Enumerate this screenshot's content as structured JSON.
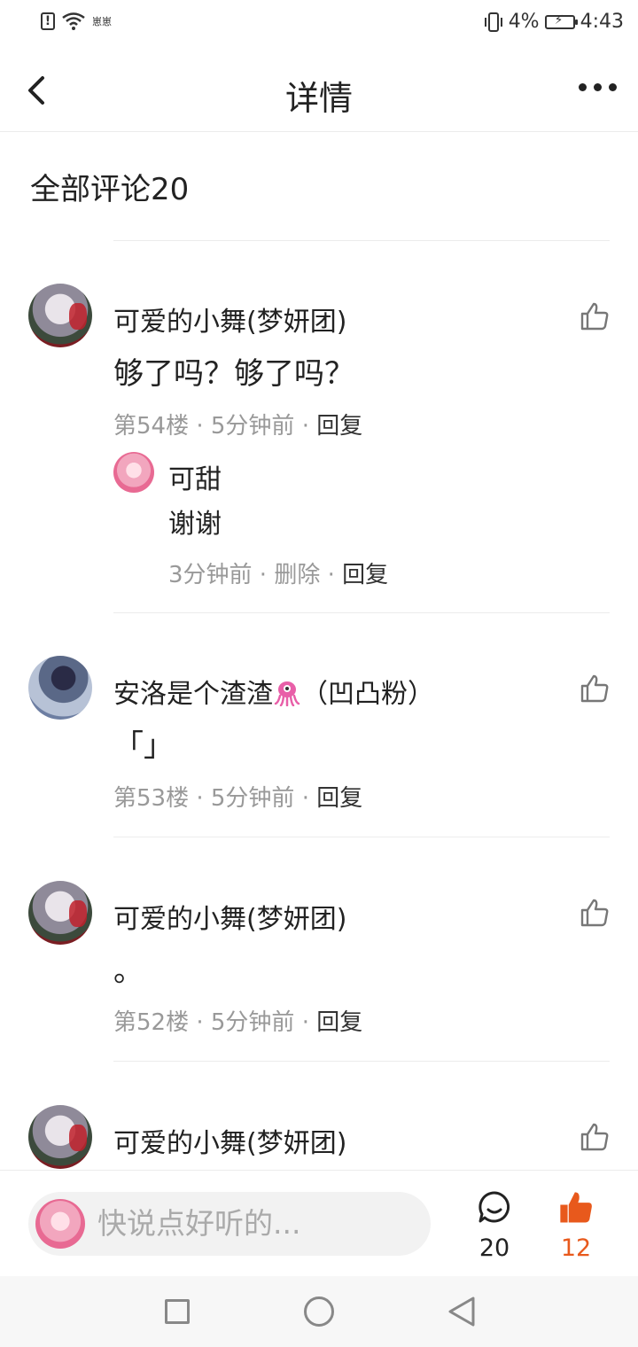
{
  "status_bar": {
    "left_small_text": "崽崽",
    "battery_percent": "4%",
    "time": "4:43"
  },
  "header": {
    "title": "详情"
  },
  "comments_section": {
    "title": "全部评论20"
  },
  "comments": [
    {
      "name": "可爱的小舞(梦妍团)",
      "content": "够了吗？够了吗？",
      "floor": "第54楼",
      "time": "5分钟前",
      "reply_label": "回复",
      "sub_reply": {
        "name": "可甜",
        "content": "谢谢",
        "time": "3分钟前",
        "delete_label": "删除",
        "reply_label": "回复"
      }
    },
    {
      "name_prefix": "安洛是个渣渣",
      "name_suffix": "（凹凸粉）",
      "content": "「」",
      "floor": "第53楼",
      "time": "5分钟前",
      "reply_label": "回复"
    },
    {
      "name": "可爱的小舞(梦妍团)",
      "content": "。",
      "floor": "第52楼",
      "time": "5分钟前",
      "reply_label": "回复"
    },
    {
      "name": "可爱的小舞(梦妍团)"
    }
  ],
  "meta_separator": " · ",
  "bottom_bar": {
    "input_placeholder": "快说点好听的...",
    "comment_count": "20",
    "like_count": "12"
  },
  "colors": {
    "accent_like": "#e8591c",
    "meta_gray": "#999999"
  }
}
